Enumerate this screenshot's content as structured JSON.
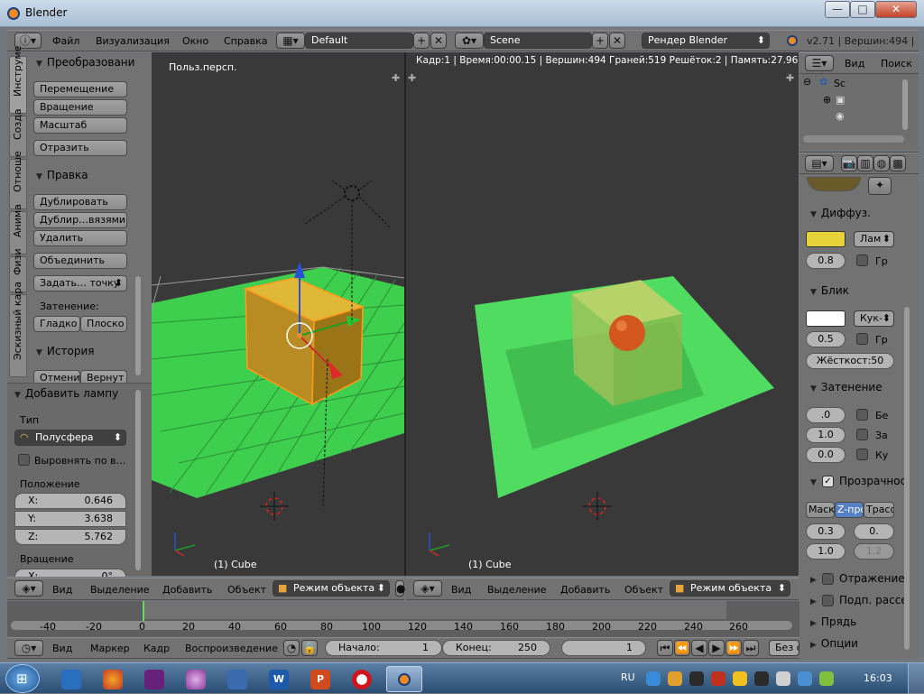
{
  "window": {
    "title": "Blender",
    "min": "—",
    "max": "□",
    "close": "✕"
  },
  "info_header": {
    "menus": [
      "Файл",
      "Визуализация",
      "Окно",
      "Справка"
    ],
    "layout": "Default",
    "scene": "Scene",
    "engine": "Рендер Blender",
    "stats": "v2.71 | Вершин:494 |"
  },
  "toolshelf": {
    "tabs": [
      "Инструме",
      "Созда",
      "Отноше",
      "Анима",
      "Физи",
      "Эскизный кара"
    ],
    "transform": {
      "title": "Преобразовани",
      "buttons": [
        "Перемещение",
        "Вращение",
        "Масштаб",
        "Отразить"
      ]
    },
    "edit": {
      "title": "Правка",
      "buttons": [
        "Дублировать",
        "Дублир…вязями",
        "Удалить",
        "Объединить",
        "Задать… точку"
      ]
    },
    "shading": {
      "label": "Затенение:",
      "smooth": "Гладко",
      "flat": "Плоско"
    },
    "history": {
      "title": "История",
      "undo": "Отмени",
      "redo": "Вернут"
    }
  },
  "operator": {
    "title": "Добавить лампу",
    "type_label": "Тип",
    "type_value": "Полусфера",
    "align_label": "Выровнять по в…",
    "location_label": "Положение",
    "x": {
      "label": "X:",
      "value": "0.646"
    },
    "y": {
      "label": "Y:",
      "value": "3.638"
    },
    "z": {
      "label": "Z:",
      "value": "5.762"
    },
    "rotation_label": "Вращение",
    "rot_x": {
      "label": "X:",
      "value": "0°"
    }
  },
  "viewport_left": {
    "label": "Польз.персп.",
    "object": "(1) Cube"
  },
  "viewport_right": {
    "stats": "Кадр:1 | Время:00:00.15 | Вершин:494 Граней:519 Решёток:2 | Память:27.96M",
    "object": "(1) Cube"
  },
  "view_header": {
    "menus": [
      "Вид",
      "Выделение",
      "Добавить",
      "Объект"
    ],
    "mode": "Режим объекта"
  },
  "outliner": {
    "view": "Вид",
    "search": "Поиск",
    "scene": "Sc"
  },
  "properties": {
    "diffuse": {
      "title": "Диффуз.",
      "color": "#e8d23a",
      "shader": "Лам",
      "intensity": "0.8",
      "ramp": "Гр"
    },
    "specular": {
      "title": "Блик",
      "color": "#ffffff",
      "shader": "Кук-",
      "intensity": "0.5",
      "ramp": "Гр",
      "hardness": "Жёсткост:50"
    },
    "shading": {
      "title": "Затенение",
      "emit": ".0",
      "ambient": "1.0",
      "translucency": "0.0",
      "be": "Бе",
      "za": "За",
      "ku": "Ку"
    },
    "transparency": {
      "title": "Прозрачнос",
      "tabs": [
        "Маск",
        "Z-про",
        "Трасс"
      ],
      "active_tab": "Z-про",
      "alpha": "0.3",
      "fresnel": "0.",
      "specular": "1.0",
      "blend": "1.2"
    },
    "mirror": "Отражение",
    "sss": "Подп. рассе",
    "strand": "Прядь",
    "options": "Опции"
  },
  "timeline": {
    "ticks": [
      "-40",
      "-20",
      "0",
      "20",
      "40",
      "60",
      "80",
      "100",
      "120",
      "140",
      "160",
      "180",
      "200",
      "220",
      "240",
      "260"
    ],
    "menus": [
      "Вид",
      "Маркер",
      "Кадр",
      "Воспроизведение"
    ],
    "start_label": "Начало:",
    "start_value": "1",
    "end_label": "Конец:",
    "end_value": "250",
    "current": "1",
    "sync": "Без с"
  },
  "taskbar": {
    "lang": "RU",
    "time": "16:03"
  },
  "colors": {
    "panel": "#727272",
    "viewport": "#393939",
    "floor": "#3fcf4f",
    "cube": "#c8a02a",
    "accent": "#5680c2"
  }
}
